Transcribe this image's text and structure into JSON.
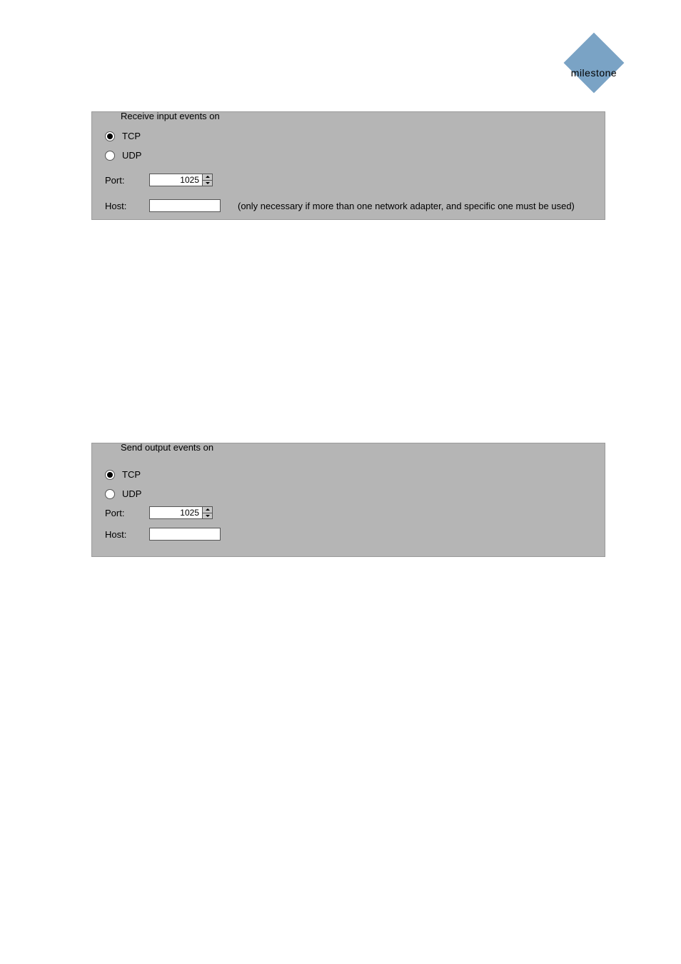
{
  "logo": {
    "text": "milestone"
  },
  "group1": {
    "legend": "Receive input events on",
    "tcp_label": "TCP",
    "udp_label": "UDP",
    "port_label": "Port:",
    "port_value": "1025",
    "host_label": "Host:",
    "host_value": "",
    "host_hint": "(only necessary if more than one network adapter, and specific one must be used)"
  },
  "group2": {
    "legend": "Send output events on",
    "tcp_label": "TCP",
    "udp_label": "UDP",
    "port_label": "Port:",
    "port_value": "1025",
    "host_label": "Host:",
    "host_value": ""
  }
}
